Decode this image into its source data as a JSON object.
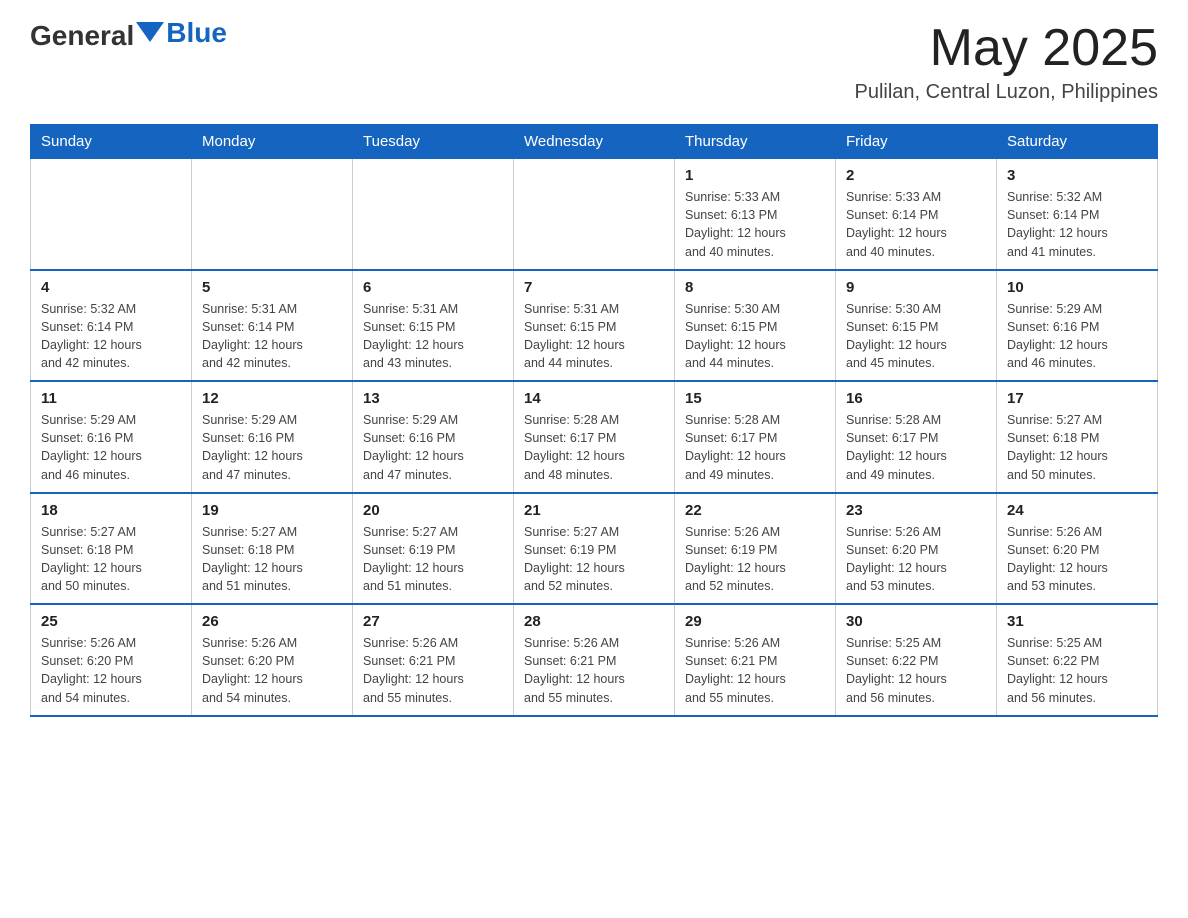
{
  "header": {
    "logo_general": "General",
    "logo_blue": "Blue",
    "month_title": "May 2025",
    "location": "Pulilan, Central Luzon, Philippines"
  },
  "days_of_week": [
    "Sunday",
    "Monday",
    "Tuesday",
    "Wednesday",
    "Thursday",
    "Friday",
    "Saturday"
  ],
  "weeks": [
    [
      {
        "day": "",
        "info": ""
      },
      {
        "day": "",
        "info": ""
      },
      {
        "day": "",
        "info": ""
      },
      {
        "day": "",
        "info": ""
      },
      {
        "day": "1",
        "info": "Sunrise: 5:33 AM\nSunset: 6:13 PM\nDaylight: 12 hours\nand 40 minutes."
      },
      {
        "day": "2",
        "info": "Sunrise: 5:33 AM\nSunset: 6:14 PM\nDaylight: 12 hours\nand 40 minutes."
      },
      {
        "day": "3",
        "info": "Sunrise: 5:32 AM\nSunset: 6:14 PM\nDaylight: 12 hours\nand 41 minutes."
      }
    ],
    [
      {
        "day": "4",
        "info": "Sunrise: 5:32 AM\nSunset: 6:14 PM\nDaylight: 12 hours\nand 42 minutes."
      },
      {
        "day": "5",
        "info": "Sunrise: 5:31 AM\nSunset: 6:14 PM\nDaylight: 12 hours\nand 42 minutes."
      },
      {
        "day": "6",
        "info": "Sunrise: 5:31 AM\nSunset: 6:15 PM\nDaylight: 12 hours\nand 43 minutes."
      },
      {
        "day": "7",
        "info": "Sunrise: 5:31 AM\nSunset: 6:15 PM\nDaylight: 12 hours\nand 44 minutes."
      },
      {
        "day": "8",
        "info": "Sunrise: 5:30 AM\nSunset: 6:15 PM\nDaylight: 12 hours\nand 44 minutes."
      },
      {
        "day": "9",
        "info": "Sunrise: 5:30 AM\nSunset: 6:15 PM\nDaylight: 12 hours\nand 45 minutes."
      },
      {
        "day": "10",
        "info": "Sunrise: 5:29 AM\nSunset: 6:16 PM\nDaylight: 12 hours\nand 46 minutes."
      }
    ],
    [
      {
        "day": "11",
        "info": "Sunrise: 5:29 AM\nSunset: 6:16 PM\nDaylight: 12 hours\nand 46 minutes."
      },
      {
        "day": "12",
        "info": "Sunrise: 5:29 AM\nSunset: 6:16 PM\nDaylight: 12 hours\nand 47 minutes."
      },
      {
        "day": "13",
        "info": "Sunrise: 5:29 AM\nSunset: 6:16 PM\nDaylight: 12 hours\nand 47 minutes."
      },
      {
        "day": "14",
        "info": "Sunrise: 5:28 AM\nSunset: 6:17 PM\nDaylight: 12 hours\nand 48 minutes."
      },
      {
        "day": "15",
        "info": "Sunrise: 5:28 AM\nSunset: 6:17 PM\nDaylight: 12 hours\nand 49 minutes."
      },
      {
        "day": "16",
        "info": "Sunrise: 5:28 AM\nSunset: 6:17 PM\nDaylight: 12 hours\nand 49 minutes."
      },
      {
        "day": "17",
        "info": "Sunrise: 5:27 AM\nSunset: 6:18 PM\nDaylight: 12 hours\nand 50 minutes."
      }
    ],
    [
      {
        "day": "18",
        "info": "Sunrise: 5:27 AM\nSunset: 6:18 PM\nDaylight: 12 hours\nand 50 minutes."
      },
      {
        "day": "19",
        "info": "Sunrise: 5:27 AM\nSunset: 6:18 PM\nDaylight: 12 hours\nand 51 minutes."
      },
      {
        "day": "20",
        "info": "Sunrise: 5:27 AM\nSunset: 6:19 PM\nDaylight: 12 hours\nand 51 minutes."
      },
      {
        "day": "21",
        "info": "Sunrise: 5:27 AM\nSunset: 6:19 PM\nDaylight: 12 hours\nand 52 minutes."
      },
      {
        "day": "22",
        "info": "Sunrise: 5:26 AM\nSunset: 6:19 PM\nDaylight: 12 hours\nand 52 minutes."
      },
      {
        "day": "23",
        "info": "Sunrise: 5:26 AM\nSunset: 6:20 PM\nDaylight: 12 hours\nand 53 minutes."
      },
      {
        "day": "24",
        "info": "Sunrise: 5:26 AM\nSunset: 6:20 PM\nDaylight: 12 hours\nand 53 minutes."
      }
    ],
    [
      {
        "day": "25",
        "info": "Sunrise: 5:26 AM\nSunset: 6:20 PM\nDaylight: 12 hours\nand 54 minutes."
      },
      {
        "day": "26",
        "info": "Sunrise: 5:26 AM\nSunset: 6:20 PM\nDaylight: 12 hours\nand 54 minutes."
      },
      {
        "day": "27",
        "info": "Sunrise: 5:26 AM\nSunset: 6:21 PM\nDaylight: 12 hours\nand 55 minutes."
      },
      {
        "day": "28",
        "info": "Sunrise: 5:26 AM\nSunset: 6:21 PM\nDaylight: 12 hours\nand 55 minutes."
      },
      {
        "day": "29",
        "info": "Sunrise: 5:26 AM\nSunset: 6:21 PM\nDaylight: 12 hours\nand 55 minutes."
      },
      {
        "day": "30",
        "info": "Sunrise: 5:25 AM\nSunset: 6:22 PM\nDaylight: 12 hours\nand 56 minutes."
      },
      {
        "day": "31",
        "info": "Sunrise: 5:25 AM\nSunset: 6:22 PM\nDaylight: 12 hours\nand 56 minutes."
      }
    ]
  ]
}
